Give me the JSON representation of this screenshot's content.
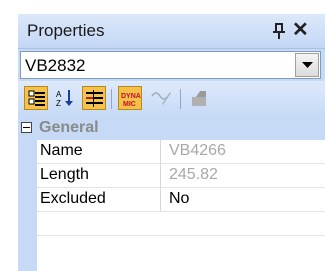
{
  "panel": {
    "title": "Properties",
    "pin_icon": "pin-icon",
    "close_glyph": "✕"
  },
  "object_selector": {
    "value": "VB2832"
  },
  "toolbar": {
    "buttons": [
      {
        "name": "categorized-view-icon",
        "active": true
      },
      {
        "name": "alphabetical-sort-icon",
        "active": false
      },
      {
        "name": "property-pages-icon",
        "active": true
      },
      {
        "name": "dynamic-properties-icon",
        "label": "DYNA MIC",
        "active": false
      },
      {
        "name": "edit-pen-icon",
        "active": false,
        "disabled": true
      },
      {
        "name": "stamp-icon",
        "active": false,
        "disabled": true
      }
    ]
  },
  "grid": {
    "category": "General",
    "rows": [
      {
        "name": "Name",
        "value": "VB4266",
        "readonly": true
      },
      {
        "name": "Length",
        "value": "245.82",
        "readonly": true
      },
      {
        "name": "Excluded",
        "value": "No",
        "readonly": false
      }
    ]
  },
  "colors": {
    "accent": "#c6d9f5",
    "active_button": "#f5c24d",
    "readonly_text": "#a8a8a8"
  }
}
